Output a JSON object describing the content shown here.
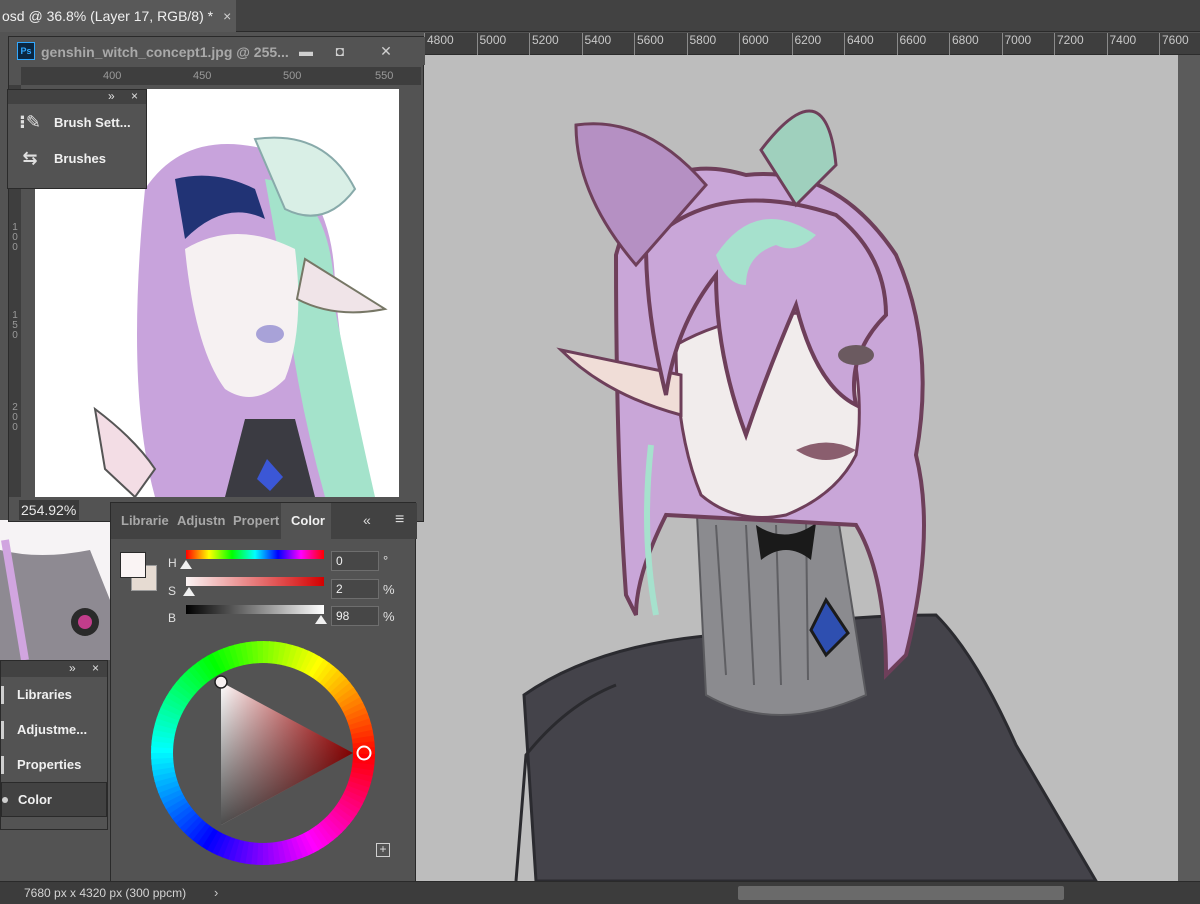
{
  "tab": {
    "title": "osd @ 36.8% (Layer 17, RGB/8) *",
    "close": "×"
  },
  "ruler": {
    "ticks": [
      "4800",
      "5000",
      "5200",
      "5400",
      "5600",
      "5800",
      "6000",
      "6200",
      "6400",
      "6600",
      "6800",
      "7000",
      "7200",
      "7400",
      "7600"
    ]
  },
  "float_window": {
    "title": "genshin_witch_concept1.jpg @ 255...",
    "app_icon": "Ps",
    "minimize": "▬",
    "maximize": "◘",
    "close": "✕",
    "ruler_ticks": [
      "400",
      "450",
      "500",
      "550"
    ],
    "vruler": [
      "1 0 0",
      "1 5 0",
      "2 0 0"
    ],
    "zoom": "254.92%"
  },
  "mini_panel": {
    "expand": "»",
    "close": "×",
    "items": [
      {
        "label": "Brush Sett...",
        "icon": "brush-settings-icon"
      },
      {
        "label": "Brushes",
        "icon": "brushes-icon"
      }
    ]
  },
  "stack_panel": {
    "expand": "»",
    "close": "×",
    "items": [
      {
        "label": "Libraries",
        "icon": "libraries-icon"
      },
      {
        "label": "Adjustme...",
        "icon": "adjustments-icon"
      },
      {
        "label": "Properties",
        "icon": "properties-icon"
      },
      {
        "label": "Color",
        "icon": "color-icon"
      }
    ]
  },
  "color_panel": {
    "tabs": [
      "Librarie",
      "Adjustn",
      "Propert",
      "Color"
    ],
    "active_tab": "Color",
    "collapse": "«",
    "menu": "≡",
    "foreground": "#faf4f4",
    "background": "#e6dbd2",
    "hsb": [
      {
        "label": "H",
        "value": "0",
        "unit": "°",
        "level": 0.0
      },
      {
        "label": "S",
        "value": "2",
        "unit": "%",
        "level": 0.02
      },
      {
        "label": "B",
        "value": "98",
        "unit": "%",
        "level": 0.98
      }
    ],
    "add": "+"
  },
  "status": {
    "doc_size": "7680 px x 4320 px (300 ppcm)",
    "arrow": "›"
  },
  "colors": {
    "hair": "#c9a6d8",
    "hair_accent": "#a6e1cd",
    "skin": "#f1ecec",
    "outline": "#6e3f5a",
    "coat": "#44434a",
    "canvas_bg": "#bcbcbc"
  }
}
